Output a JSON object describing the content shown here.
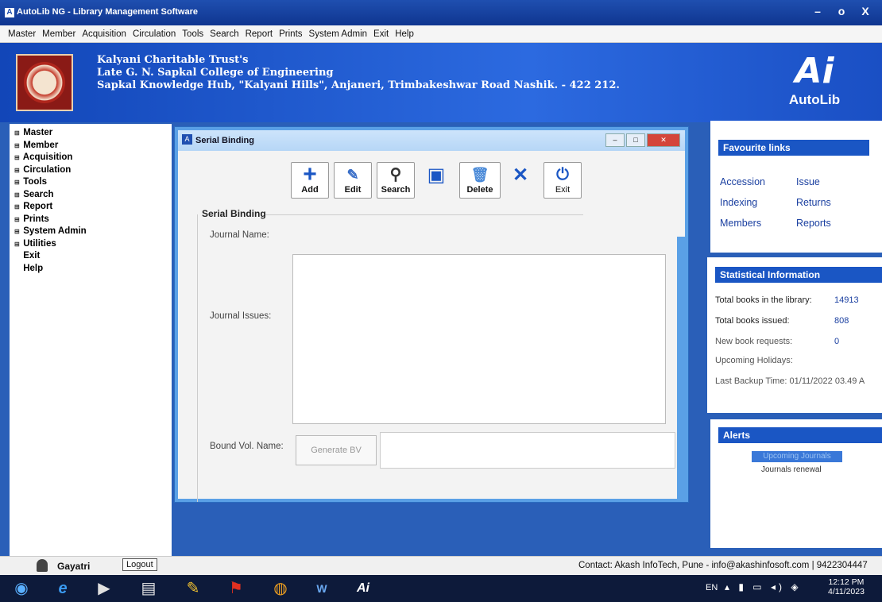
{
  "window": {
    "title": "AutoLib NG - Library Management Software",
    "min": "–",
    "max": "o",
    "close": "X"
  },
  "menu": [
    "Master",
    "Member",
    "Acquisition",
    "Circulation",
    "Tools",
    "Search",
    "Report",
    "Prints",
    "System Admin",
    "Exit",
    "Help"
  ],
  "banner": {
    "line1": "Kalyani Charitable Trust's",
    "line2": "Late G. N. Sapkal College of Engineering",
    "line3": "Sapkal Knowledge Hub, \"Kalyani Hills\", Anjaneri, Trimbakeshwar Road Nashik. - 422 212.",
    "brand": "AutoLib",
    "brand_mark": "Ai"
  },
  "nav": [
    "Master",
    "Member",
    "Acquisition",
    "Circulation",
    "Tools",
    "Search",
    "Report",
    "Prints",
    "System Admin",
    "Utilities",
    "Exit",
    "Help"
  ],
  "dialog": {
    "title": "Serial Binding",
    "toolbar": {
      "add": "Add",
      "edit": "Edit",
      "search": "Search",
      "delete": "Delete",
      "exit": "Exit"
    },
    "group": "Serial Binding",
    "journal_name": "Journal Name:",
    "journal_issues": "Journal Issues:",
    "bound_vol": "Bound Vol. Name:",
    "generate_bv": "Generate BV"
  },
  "favourites": {
    "title": "Favourite links",
    "links": [
      "Accession",
      "Issue",
      "Indexing",
      "Returns",
      "Members",
      "Reports"
    ]
  },
  "stats": {
    "title": "Statistical Information",
    "total_books_label": "Total books in the library:",
    "total_books": "14913",
    "issued_label": "Total books issued:",
    "issued": "808",
    "requests_label": "New book requests:",
    "requests": "0",
    "holidays_label": "Upcoming Holidays:",
    "backup_label": "Last Backup Time: 01/11/2022 03.49 A"
  },
  "alerts": {
    "title": "Alerts",
    "item": "Upcoming Journals",
    "sub": "Journals renewal"
  },
  "status": {
    "user": "Gayatri",
    "logout": "Logout",
    "contact": "Contact: Akash InfoTech, Pune - info@akashinfosoft.com | 9422304447"
  },
  "taskbar": {
    "lang": "EN",
    "time": "12:12 PM",
    "date": "4/11/2023"
  }
}
